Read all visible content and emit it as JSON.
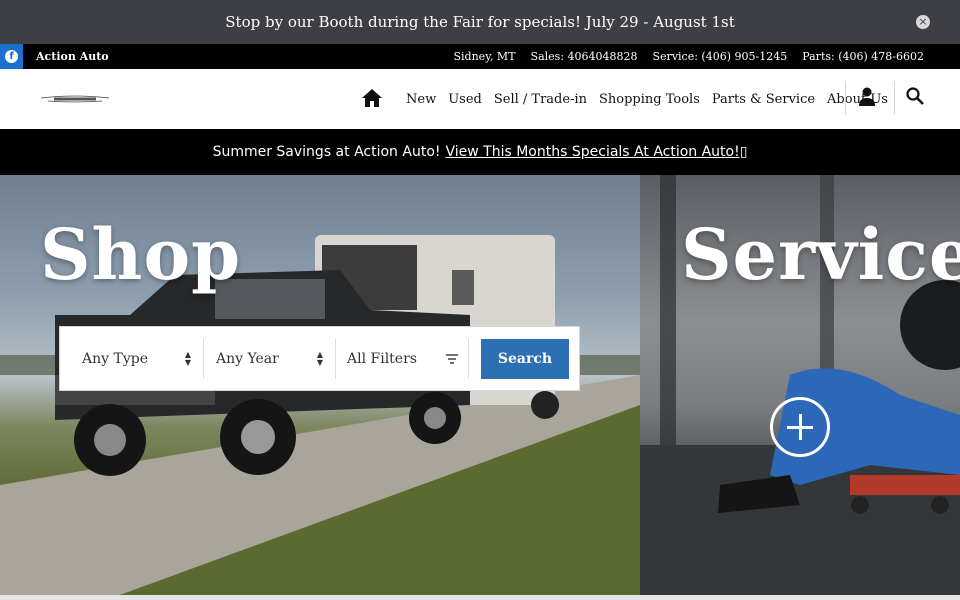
{
  "announcement": {
    "text": "Stop by our Booth during the Fair for specials! July 29 - August 1st",
    "close_glyph": "×"
  },
  "topbar": {
    "facebook_glyph": "f",
    "dealer_name": "Action Auto",
    "location": "Sidney, MT",
    "sales": "Sales: 4064048828",
    "service": "Service: (406) 905-1245",
    "parts": "Parts: (406) 478-6602"
  },
  "nav": {
    "items": [
      "New",
      "Used",
      "Sell / Trade-in",
      "Shopping Tools",
      "Parts & Service",
      "About Us"
    ]
  },
  "promo": {
    "text": "Summer Savings at Action Auto!",
    "link": "View This Months Specials At Action Auto!▯"
  },
  "hero": {
    "shop_title": "Shop",
    "service_title": "Service"
  },
  "search": {
    "type_label": "Any Type",
    "year_label": "Any Year",
    "filters_label": "All Filters",
    "button_label": "Search"
  },
  "colors": {
    "announcement_bg": "#3d3f45",
    "facebook_blue": "#1a6fcf",
    "search_button": "#2d6fb3"
  },
  "icons": [
    "facebook-icon",
    "close-icon",
    "chrysler-logo",
    "home-icon",
    "user-icon",
    "search-icon",
    "filter-icon",
    "plus-circle-icon"
  ]
}
